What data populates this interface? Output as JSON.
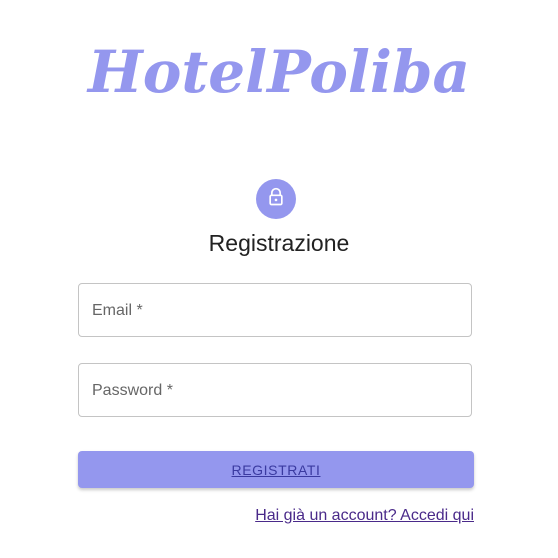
{
  "brand": {
    "title": "HotelPoliba"
  },
  "header": {
    "icon": "lock-icon",
    "title": "Registrazione"
  },
  "form": {
    "email": {
      "label": "Email *",
      "value": ""
    },
    "password": {
      "label": "Password *",
      "value": ""
    },
    "submit_label": "REGISTRATI",
    "login_link": "Hai già un account? Accedi qui"
  },
  "colors": {
    "accent": "#9497ee",
    "link": "#4a2a8a",
    "button_text": "#3a3aa0"
  }
}
